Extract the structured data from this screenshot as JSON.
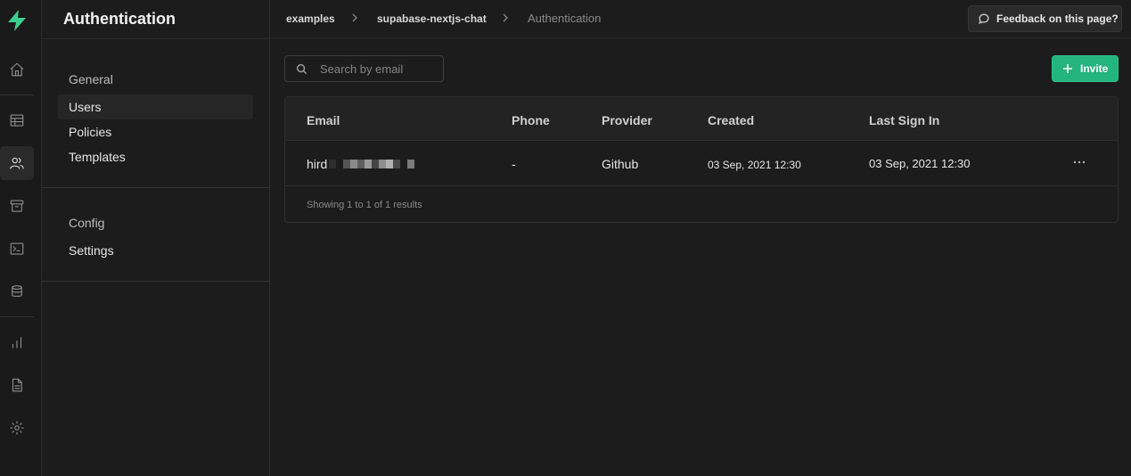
{
  "nav": {
    "logo_icon": "supabase-bolt-icon",
    "brand_color": "#3ecf8e",
    "items": [
      {
        "icon": "home-icon"
      },
      {
        "icon": "table-editor-icon"
      },
      {
        "icon": "users-icon",
        "active": true
      },
      {
        "icon": "storage-icon"
      },
      {
        "icon": "sql-terminal-icon"
      },
      {
        "icon": "database-icon"
      },
      {
        "icon": "reports-chart-icon"
      },
      {
        "icon": "docs-file-icon"
      },
      {
        "icon": "settings-gear-icon"
      }
    ]
  },
  "menu": {
    "title": "Authentication",
    "sections": [
      {
        "title": "General",
        "items": [
          "Users",
          "Policies",
          "Templates"
        ]
      },
      {
        "title": "Config",
        "items": [
          "Settings"
        ]
      }
    ],
    "active_item": "Users"
  },
  "breadcrumb": {
    "items": [
      "examples",
      "supabase-nextjs-chat",
      "Authentication"
    ]
  },
  "feedback_label": "Feedback on this page?",
  "toolbar": {
    "search_placeholder": "Search by email",
    "search_value": "",
    "invite_label": "Invite",
    "accent": "#24b47e"
  },
  "table": {
    "columns": [
      "Email",
      "Phone",
      "Provider",
      "Created",
      "Last Sign In"
    ],
    "rows": [
      {
        "email": "hird",
        "phone": "-",
        "provider": "Github",
        "created": "03 Sep, 2021 12:30",
        "last_sign_in": "03 Sep, 2021 12:30"
      }
    ],
    "footer": "Showing 1 to 1 of 1 results"
  }
}
